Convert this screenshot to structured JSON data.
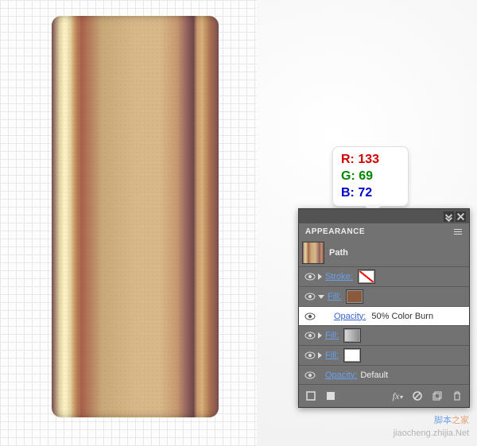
{
  "tooltip": {
    "r_label": "R:",
    "r_value": "133",
    "g_label": "G:",
    "g_value": "69",
    "b_label": "B:",
    "b_value": "72"
  },
  "panel": {
    "title": "APPEARANCE",
    "path_label": "Path",
    "rows": [
      {
        "link": "Stroke:"
      },
      {
        "link": "Fill:"
      },
      {
        "link": "Opacity:",
        "value": "50% Color Burn"
      },
      {
        "link": "Fill:"
      },
      {
        "link": "Fill:"
      },
      {
        "link": "Opacity:",
        "value": "Default"
      }
    ]
  },
  "watermark": {
    "line1_a": "脚本",
    "line1_b": "之家",
    "line2": "jiaocheng.zhijia.Net"
  }
}
